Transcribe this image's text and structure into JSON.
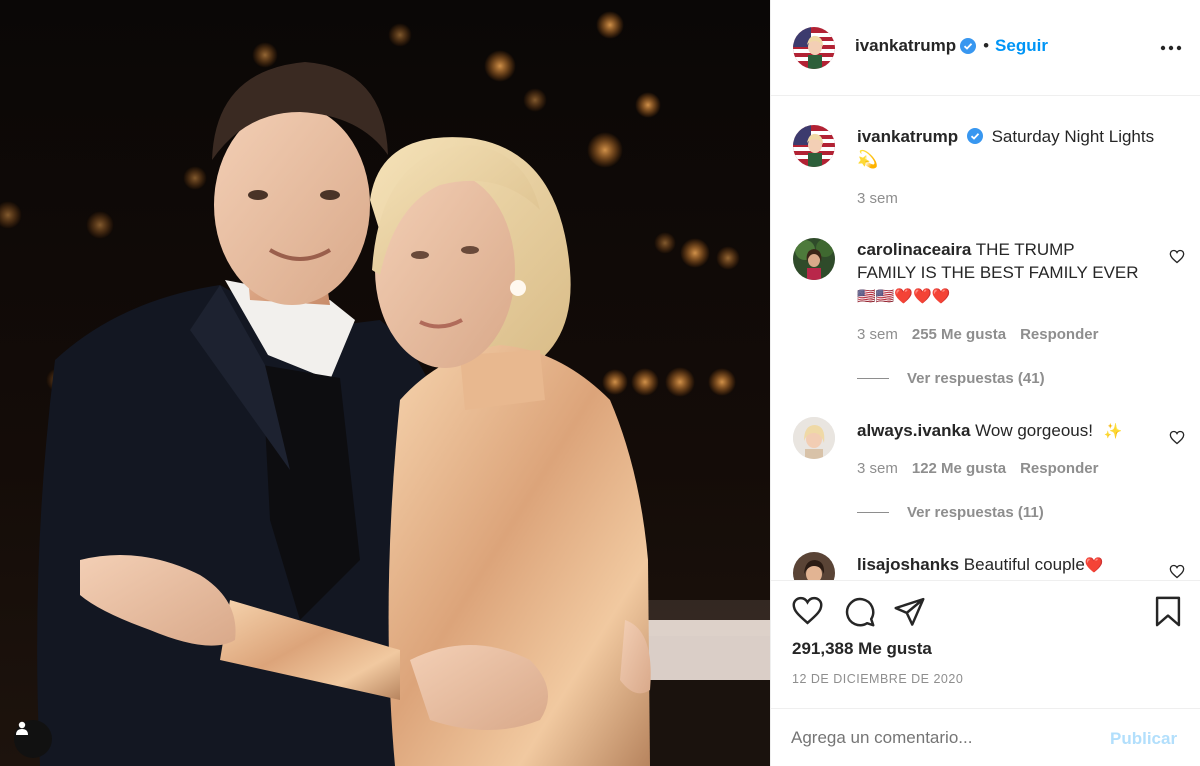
{
  "post": {
    "author": "ivankatrump",
    "follow_label": "Seguir",
    "dot": "•",
    "caption": "Saturday Night Lights",
    "caption_emoji": "💫",
    "caption_time": "3 sem"
  },
  "comments": [
    {
      "user": "carolinaceaira",
      "text_line1": "THE TRUMP",
      "text_line2": "FAMILY IS THE BEST FAMILY EVER",
      "emojis": "🇺🇸🇺🇸❤️❤️❤️",
      "time": "3 sem",
      "likes": "255 Me gusta",
      "reply": "Responder",
      "view_replies": "Ver respuestas (41)"
    },
    {
      "user": "always.ivanka",
      "text": "Wow gorgeous!",
      "emoji": "✨",
      "time": "3 sem",
      "likes": "122 Me gusta",
      "reply": "Responder",
      "view_replies": "Ver respuestas (11)"
    },
    {
      "user": "lisajoshanks",
      "text": "Beautiful couple",
      "emoji": "❤️"
    }
  ],
  "stats": {
    "likes": "291,388 Me gusta",
    "date": "12 DE DICIEMBRE DE 2020"
  },
  "composer": {
    "placeholder": "Agrega un comentario...",
    "publish_label": "Publicar"
  },
  "colors": {
    "accent": "#0095f6",
    "publish_disabled": "#b2dffc",
    "verified": "#3897f0",
    "muted": "#8e8e8e"
  },
  "icons": [
    "heart-icon",
    "comment-icon",
    "share-icon",
    "bookmark-icon",
    "more-icon",
    "verified-icon",
    "user-tag-icon"
  ]
}
